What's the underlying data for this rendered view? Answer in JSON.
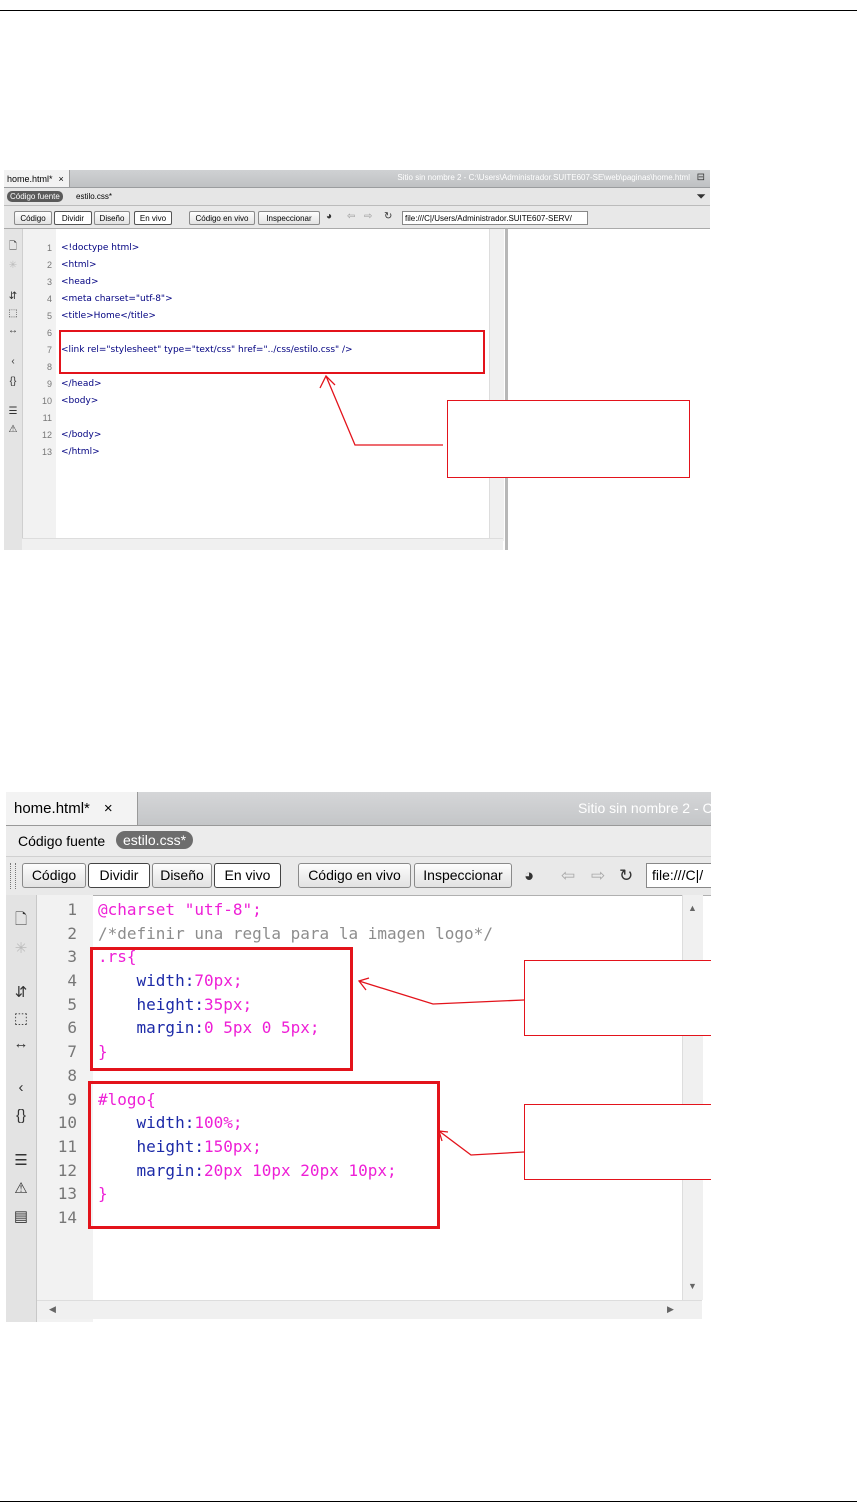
{
  "screenshot1": {
    "doc_tab": "home.html*",
    "site_path": "Sitio sin nombre 2 - C:\\Users\\Administrador.SUITE607-SE\\web\\paginas\\home.html",
    "related_files": [
      "Código fuente",
      "estilo.css*"
    ],
    "toolbar": {
      "code": "Código",
      "split": "Dividir",
      "design": "Diseño",
      "live": "En vivo",
      "live_code": "Código en vivo",
      "inspect": "Inspeccionar",
      "url": "file:///C|/Users/Administrador.SUITE607-SERV/"
    },
    "line_numbers": [
      "1",
      "2",
      "3",
      "4",
      "5",
      "6",
      "7",
      "8",
      "9",
      "10",
      "11",
      "12",
      "13"
    ],
    "code_lines": [
      "<!doctype html>",
      "<html>",
      "<head>",
      "<meta charset=\"utf-8\">",
      "<title>Home</title>",
      "",
      "<link rel=\"stylesheet\" type=\"text/css\" href=\"../css/estilo.css\" />",
      "",
      "</head>",
      "<body>",
      "",
      "</body>",
      "</html>"
    ]
  },
  "screenshot2": {
    "doc_tab": "home.html*",
    "site_path": "Sitio sin nombre 2 - C",
    "related_files": [
      "Código fuente",
      "estilo.css*"
    ],
    "toolbar": {
      "code": "Código",
      "split": "Dividir",
      "design": "Diseño",
      "live": "En vivo",
      "live_code": "Código en vivo",
      "inspect": "Inspeccionar",
      "url": "file:///C|/"
    },
    "line_numbers": [
      "1",
      "2",
      "3",
      "4",
      "5",
      "6",
      "7",
      "8",
      "9",
      "10",
      "11",
      "12",
      "13",
      "14"
    ],
    "code": {
      "l1_at": "@charset",
      "l1_str": " \"utf-8\";",
      "l2": "/*definir una regla para la imagen logo*/",
      "l3": ".rs{",
      "l4_prop": "    width:",
      "l4_val": "70px;",
      "l5_prop": "    height:",
      "l5_val": "35px;",
      "l6_prop": "    margin:",
      "l6_val": "0 5px 0 5px;",
      "l7": "}",
      "l9": "#logo{",
      "l10_prop": "    width:",
      "l10_val": "100%;",
      "l11_prop": "    height:",
      "l11_val": "150px;",
      "l12_prop": "    margin:",
      "l12_val": "20px 10px 20px 10px;",
      "l13": "}"
    }
  },
  "colors": {
    "annotation": "#e3131b",
    "css_keyword": "#ee1fd6",
    "css_property": "#1c2aa8",
    "comment": "#8d8d8d",
    "html_tag": "#000080"
  },
  "icons": [
    "close-icon",
    "restore-icon",
    "filter-icon",
    "globe-icon",
    "back-arrow-icon",
    "forward-arrow-icon",
    "refresh-icon",
    "new-file-icon",
    "collapse-icon",
    "expand-icon",
    "select-parent-icon",
    "balance-braces-icon",
    "line-numbers-icon",
    "syntax-error-icon",
    "comment-icon"
  ]
}
